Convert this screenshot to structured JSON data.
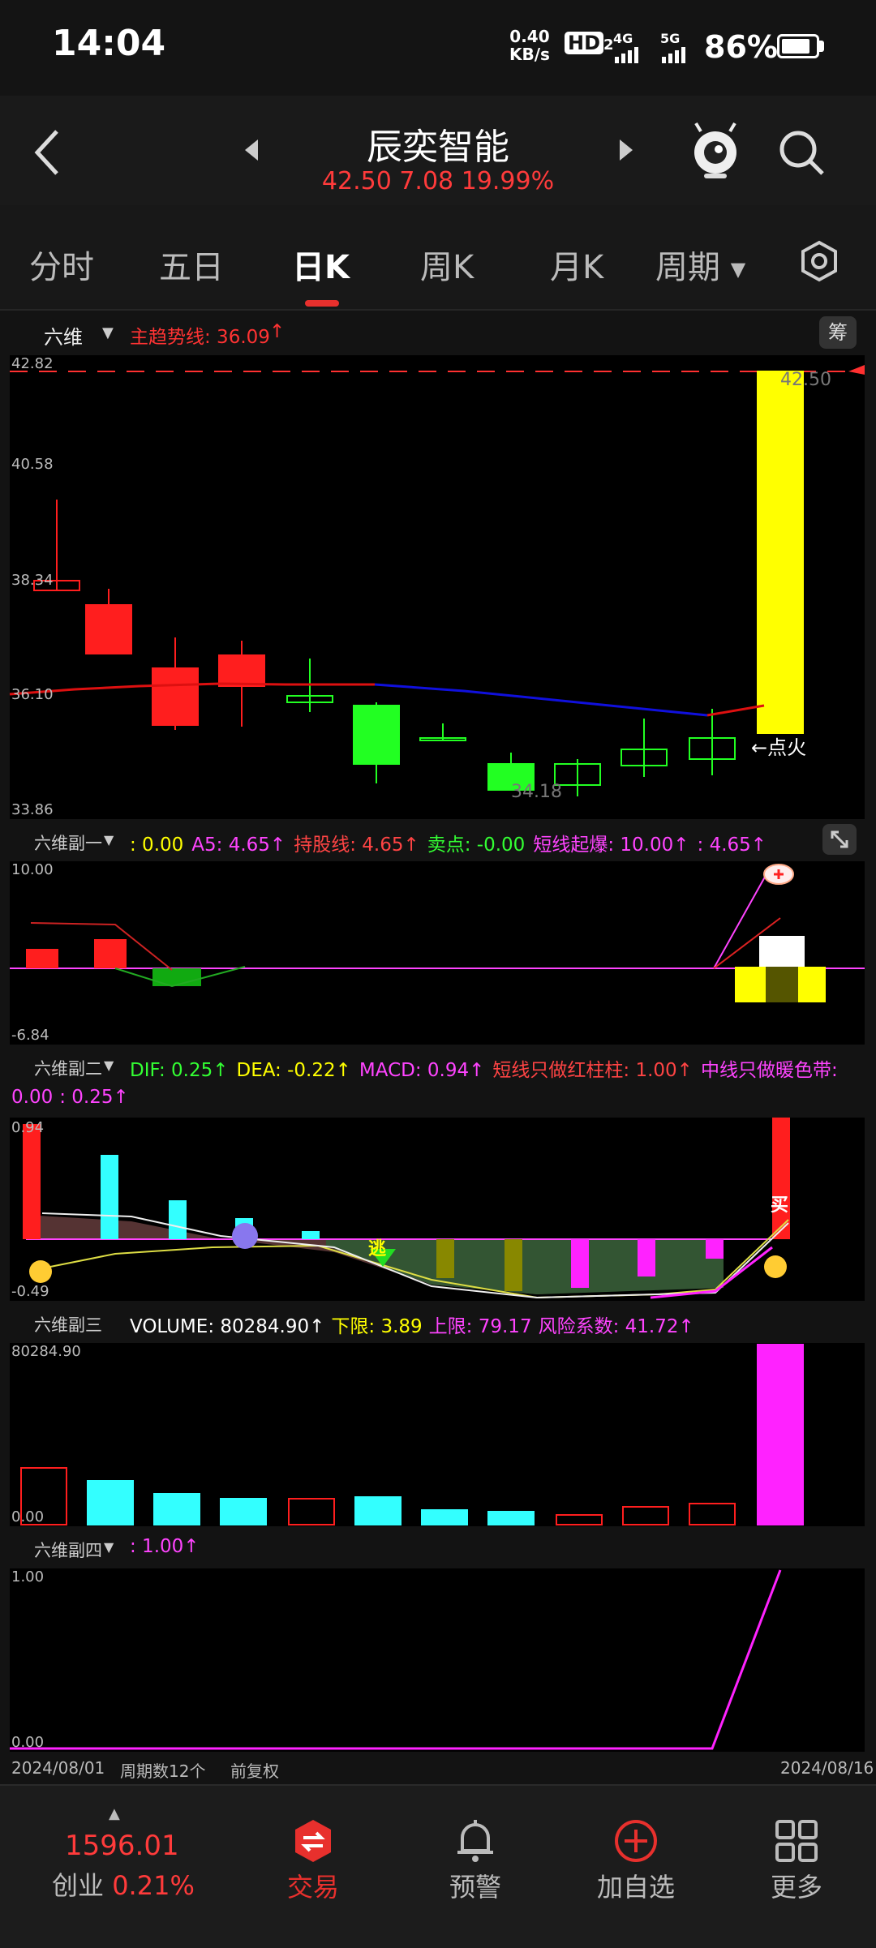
{
  "status_bar": {
    "time": "14:04",
    "net_speed_value": "0.40",
    "net_speed_unit": "KB/s",
    "hd": "HD",
    "hd_sub": "2",
    "sig1": "4G",
    "sig2": "5G",
    "battery": "86%",
    "battery_level": 0.86
  },
  "header": {
    "title": "辰奕智能",
    "price": "42.50",
    "change": "7.08",
    "change_pct": "19.99%"
  },
  "tabs": [
    {
      "label": "分时"
    },
    {
      "label": "五日"
    },
    {
      "label": "日K",
      "active": true
    },
    {
      "label": "周K"
    },
    {
      "label": "月K"
    },
    {
      "label": "周期"
    }
  ],
  "main_panel": {
    "name": "六维",
    "indicator": "主趋势线: 36.09",
    "badge": "筹",
    "axis": [
      "42.82",
      "40.58",
      "38.34",
      "36.10",
      "33.86"
    ],
    "high_label": "42.50",
    "low_label": "34.18",
    "signal": "←点火"
  },
  "sub1": {
    "name": "六维副一",
    "items": [
      {
        "text": ": 0.00",
        "color": "#ffff00"
      },
      {
        "text": "A5: 4.65↑",
        "color": "#ff44ff"
      },
      {
        "text": "持股线: 4.65↑",
        "color": "#ff4444"
      },
      {
        "text": "卖点: -0.00",
        "color": "#33ff33"
      },
      {
        "text": "短线起爆: 10.00↑",
        "color": "#ff44ff"
      },
      {
        "text": ": 4.65↑",
        "color": "#ff44ff"
      }
    ],
    "axis_top": "10.00",
    "axis_bottom": "-6.84"
  },
  "sub2": {
    "name": "六维副二",
    "items": [
      {
        "text": "DIF: 0.25↑",
        "color": "#33ff33"
      },
      {
        "text": "DEA: -0.22↑",
        "color": "#ffff00"
      },
      {
        "text": "MACD: 0.94↑",
        "color": "#ff44ff"
      },
      {
        "text": "短线只做红柱柱: 1.00↑",
        "color": "#ff4444"
      },
      {
        "text": "中线只做暖色带:",
        "color": "#ff44ff"
      }
    ],
    "items_line2": [
      {
        "text": "0.00",
        "color": "#ff44ff"
      },
      {
        "text": ": 0.25↑",
        "color": "#ff44ff"
      }
    ],
    "axis_top": "0.94",
    "axis_bottom": "-0.49",
    "escape_label": "逃",
    "buy_label": "买"
  },
  "sub3": {
    "name": "六维副三",
    "items": [
      {
        "text": "VOLUME: 80284.90↑",
        "color": "#ffffff"
      },
      {
        "text": "下限: 3.89",
        "color": "#ffff00"
      },
      {
        "text": "上限: 79.17",
        "color": "#ff44ff"
      },
      {
        "text": "风险系数: 41.72↑",
        "color": "#ff44ff"
      }
    ],
    "axis_top": "80284.90",
    "axis_bottom": "0.00"
  },
  "sub4": {
    "name": "六维副四",
    "items": [
      {
        "text": ": 1.00↑",
        "color": "#ff44ff"
      }
    ],
    "axis_top": "1.00",
    "axis_bottom": "0.00"
  },
  "footer_info": {
    "start_date": "2024/08/01",
    "periods": "周期数12个",
    "adjust": "前复权",
    "end_date": "2024/08/16"
  },
  "bottom_nav": {
    "index_value": "1596.01",
    "index_name": "创业",
    "index_pct": "0.21%",
    "trade": "交易",
    "alert": "预警",
    "add": "加自选",
    "more": "更多"
  },
  "colors": {
    "up": "#ff1e1e",
    "down": "#22ff22",
    "accent": "#e8302d",
    "trend_blue": "#1010dd",
    "magenta": "#ff22ff",
    "yellow": "#ffff00",
    "cyan": "#33ffff"
  }
}
